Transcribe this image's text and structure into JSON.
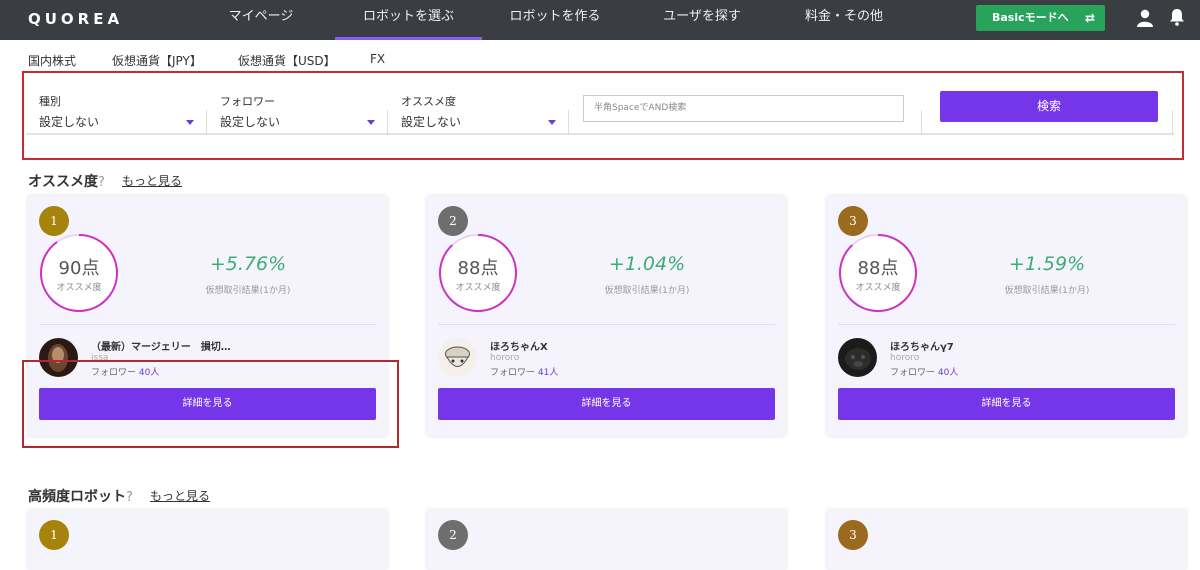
{
  "app": {
    "logo": "QUOREA"
  },
  "nav": {
    "items": [
      "マイページ",
      "ロボットを選ぶ",
      "ロボットを作る",
      "ユーザを探す",
      "料金・その他"
    ],
    "active_index": 1,
    "basic_mode_label": "Basicモードへ",
    "basic_mode_icon": "⇄"
  },
  "subtabs": [
    "国内株式",
    "仮想通貨【JPY】",
    "仮想通貨【USD】",
    "FX"
  ],
  "filters": {
    "kind": {
      "label": "種別",
      "value": "設定しない"
    },
    "followers": {
      "label": "フォロワー",
      "value": "設定しない"
    },
    "recommend": {
      "label": "オススメ度",
      "value": "設定しない"
    },
    "search_placeholder": "半角SpaceでAND検索",
    "search_button": "検索"
  },
  "recommended": {
    "title": "オススメ度",
    "help": "?",
    "more": "もっと見る",
    "score_label": "オススメ度",
    "result_label": "仮想取引結果(1か月)",
    "followers_label": "フォロワー",
    "detail_label": "詳細を見る",
    "cards": [
      {
        "rank": "1",
        "score": "90点",
        "pct": "+5.76%",
        "name": "（最新）マージェリー　損切…",
        "user": "issa",
        "followers": "40人",
        "badge_color": "#a6840c",
        "score_fraction": 0.9
      },
      {
        "rank": "2",
        "score": "88点",
        "pct": "+1.04%",
        "name": "ほろちゃんX",
        "user": "hororo",
        "followers": "41人",
        "badge_color": "#6e6e6e",
        "score_fraction": 0.88
      },
      {
        "rank": "3",
        "score": "88点",
        "pct": "+1.59%",
        "name": "ほろちゃんγ7",
        "user": "hororo",
        "followers": "40人",
        "badge_color": "#9a6a1e",
        "score_fraction": 0.88
      }
    ]
  },
  "high_freq": {
    "title": "高頻度ロボット",
    "help": "?",
    "more": "もっと見る",
    "cards": [
      {
        "rank": "1",
        "badge_color": "#a6840c"
      },
      {
        "rank": "2",
        "badge_color": "#6e6e6e"
      },
      {
        "rank": "3",
        "badge_color": "#9a6a1e"
      }
    ]
  }
}
